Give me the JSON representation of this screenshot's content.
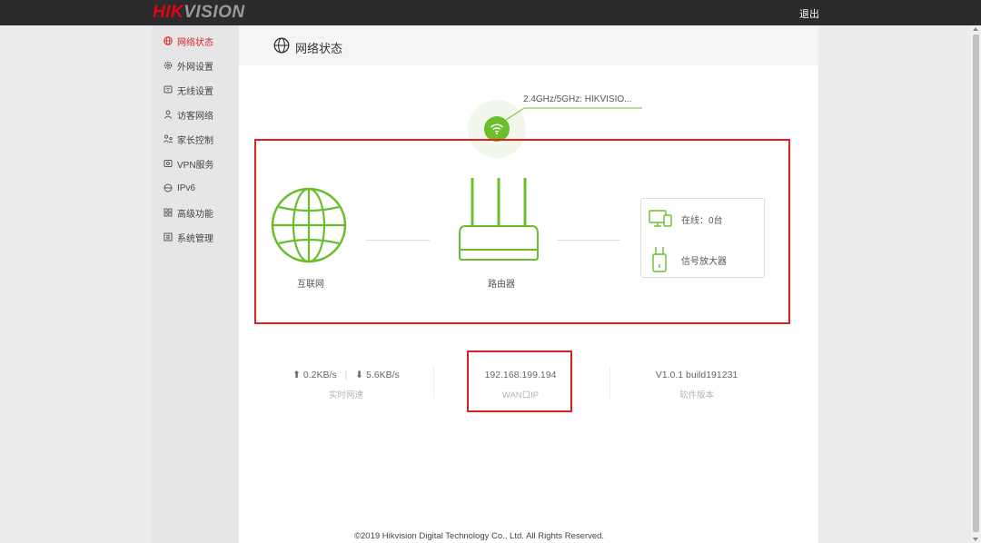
{
  "brand": {
    "part1": "HIK",
    "part2": "VISION"
  },
  "header": {
    "logout": "退出"
  },
  "sidebar": {
    "items": [
      {
        "label": "网络状态",
        "icon": "globe-icon",
        "active": true
      },
      {
        "label": "外网设置",
        "icon": "gear-icon"
      },
      {
        "label": "无线设置",
        "icon": "wifi-box-icon"
      },
      {
        "label": "访客网络",
        "icon": "guest-user-icon"
      },
      {
        "label": "家长控制",
        "icon": "parent-child-icon"
      },
      {
        "label": "VPN服务",
        "icon": "vpn-shield-icon"
      },
      {
        "label": "IPv6",
        "icon": "ipv6-icon"
      },
      {
        "label": "高级功能",
        "icon": "grid-icon"
      },
      {
        "label": "系统管理",
        "icon": "system-icon"
      }
    ]
  },
  "page": {
    "title": "网络状态"
  },
  "wifi": {
    "ssid": "2.4GHz/5GHz: HIKVISIO..."
  },
  "topology": {
    "internet_label": "互联网",
    "router_label": "路由器",
    "online_devices": "在线：0台",
    "extender_label": "信号放大器"
  },
  "stats": {
    "upload": "0.2KB/s",
    "separator": "|",
    "download": "5.6KB/s",
    "speed_label": "实时网速",
    "wan_ip": "192.168.199.194",
    "wan_label": "WAN口IP",
    "firmware": "V1.0.1 build191231",
    "firmware_label": "软件版本"
  },
  "footer": {
    "copyright": "©2019 Hikvision Digital Technology Co., Ltd. All Rights Reserved."
  },
  "colors": {
    "accent_green": "#6cbd2c",
    "active_red": "#d8232a",
    "highlight_red": "#e2201b",
    "topbar": "#2b2b2b"
  }
}
